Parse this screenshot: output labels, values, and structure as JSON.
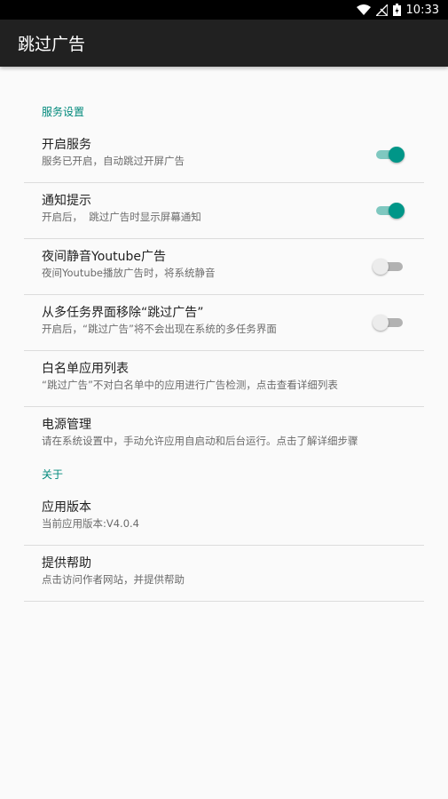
{
  "status_bar": {
    "time": "10:33",
    "icons": [
      "wifi-icon",
      "signal-icon",
      "battery-icon"
    ]
  },
  "app_bar": {
    "title": "跳过广告"
  },
  "categories": {
    "service": "服务设置",
    "about": "关于"
  },
  "prefs": [
    {
      "title": "开启服务",
      "summary": "服务已开启，自动跳过开屏广告",
      "switch": true,
      "checked": true
    },
    {
      "title": "通知提示",
      "summary": "开启后，  跳过广告时显示屏幕通知",
      "switch": true,
      "checked": true
    },
    {
      "title": "夜间静音Youtube广告",
      "summary": "夜间Youtube播放广告时，将系统静音",
      "switch": true,
      "checked": false
    },
    {
      "title": "从多任务界面移除“跳过广告”",
      "summary": "开启后，“跳过广告”将不会出现在系统的多任务界面",
      "switch": true,
      "checked": false
    },
    {
      "title": "白名单应用列表",
      "summary": "“跳过广告”不对白名单中的应用进行广告检测，点击查看详细列表",
      "switch": false
    },
    {
      "title": "电源管理",
      "summary": "请在系统设置中，手动允许应用自启动和后台运行。点击了解详细步骤",
      "switch": false
    },
    {
      "title": "应用版本",
      "summary": "当前应用版本:V4.0.4",
      "switch": false
    },
    {
      "title": "提供帮助",
      "summary": "点击访问作者网站，并提供帮助",
      "switch": false
    }
  ],
  "colors": {
    "accent": "#009688",
    "toolbar": "#212121",
    "category_text": "#00897b"
  }
}
